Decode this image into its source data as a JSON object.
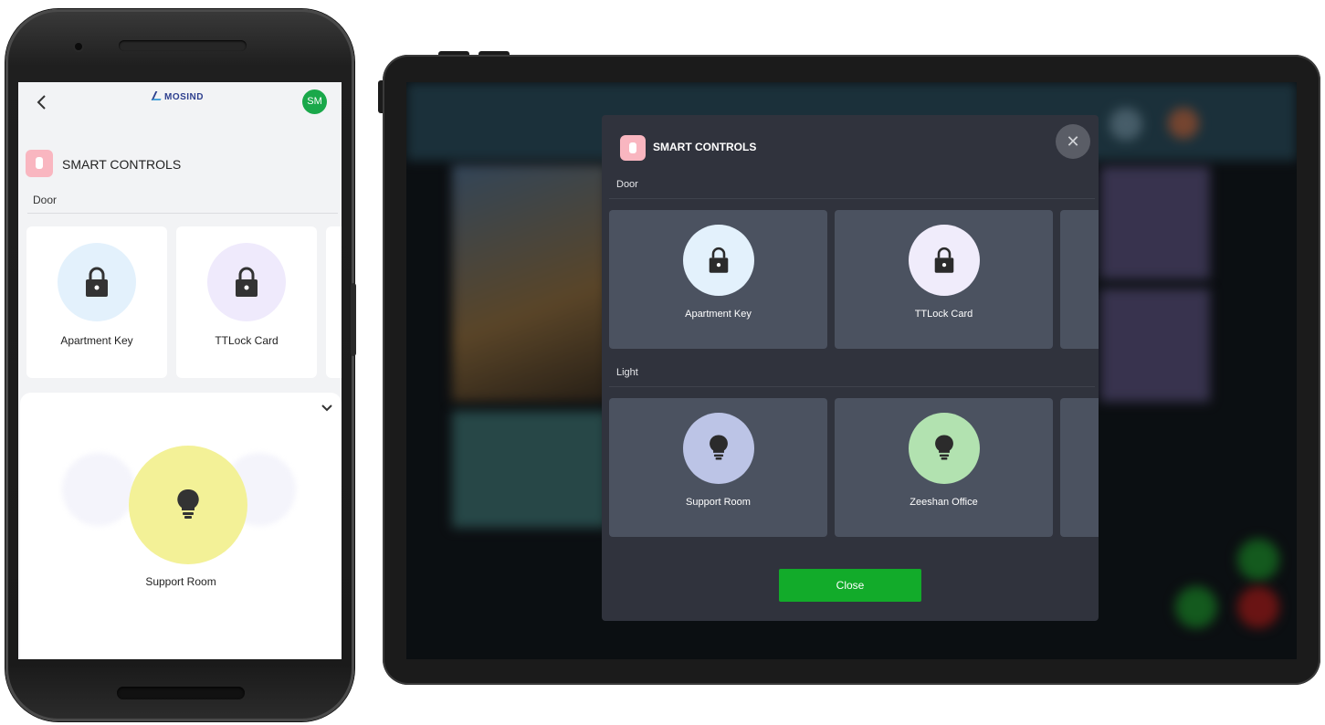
{
  "phone": {
    "header": {
      "back_icon": "chevron-left-icon",
      "logo_text": "MOSIND",
      "avatar_initials": "SM",
      "avatar_color": "#1aa84a"
    },
    "section_title": "SMART CONTROLS",
    "section_icon": "smart-control-icon",
    "group_label": "Door",
    "door_items": [
      {
        "label": "Apartment Key",
        "icon": "lock-icon",
        "color": "#e3f1fc"
      },
      {
        "label": "TTLock Card",
        "icon": "lock-icon",
        "color": "#efeafc"
      }
    ],
    "sheet": {
      "collapse_icon": "chevron-down-icon",
      "selected_label": "Support Room",
      "selected_icon": "bulb-icon",
      "selected_color": "#f3f197"
    }
  },
  "tablet": {
    "modal": {
      "title": "SMART CONTROLS",
      "close_icon": "close-icon",
      "groups": [
        {
          "label": "Door",
          "items": [
            {
              "label": "Apartment Key",
              "icon": "lock-icon",
              "color": "#e3f1fc"
            },
            {
              "label": "TTLock Card",
              "icon": "lock-icon",
              "color": "#f0ecfb"
            }
          ]
        },
        {
          "label": "Light",
          "items": [
            {
              "label": "Support Room",
              "icon": "bulb-icon",
              "color": "#bcc4e6"
            },
            {
              "label": "Zeeshan Office",
              "icon": "bulb-icon",
              "color": "#b2e2b0"
            }
          ]
        }
      ],
      "close_button_label": "Close",
      "close_button_color": "#12ab2a"
    }
  }
}
